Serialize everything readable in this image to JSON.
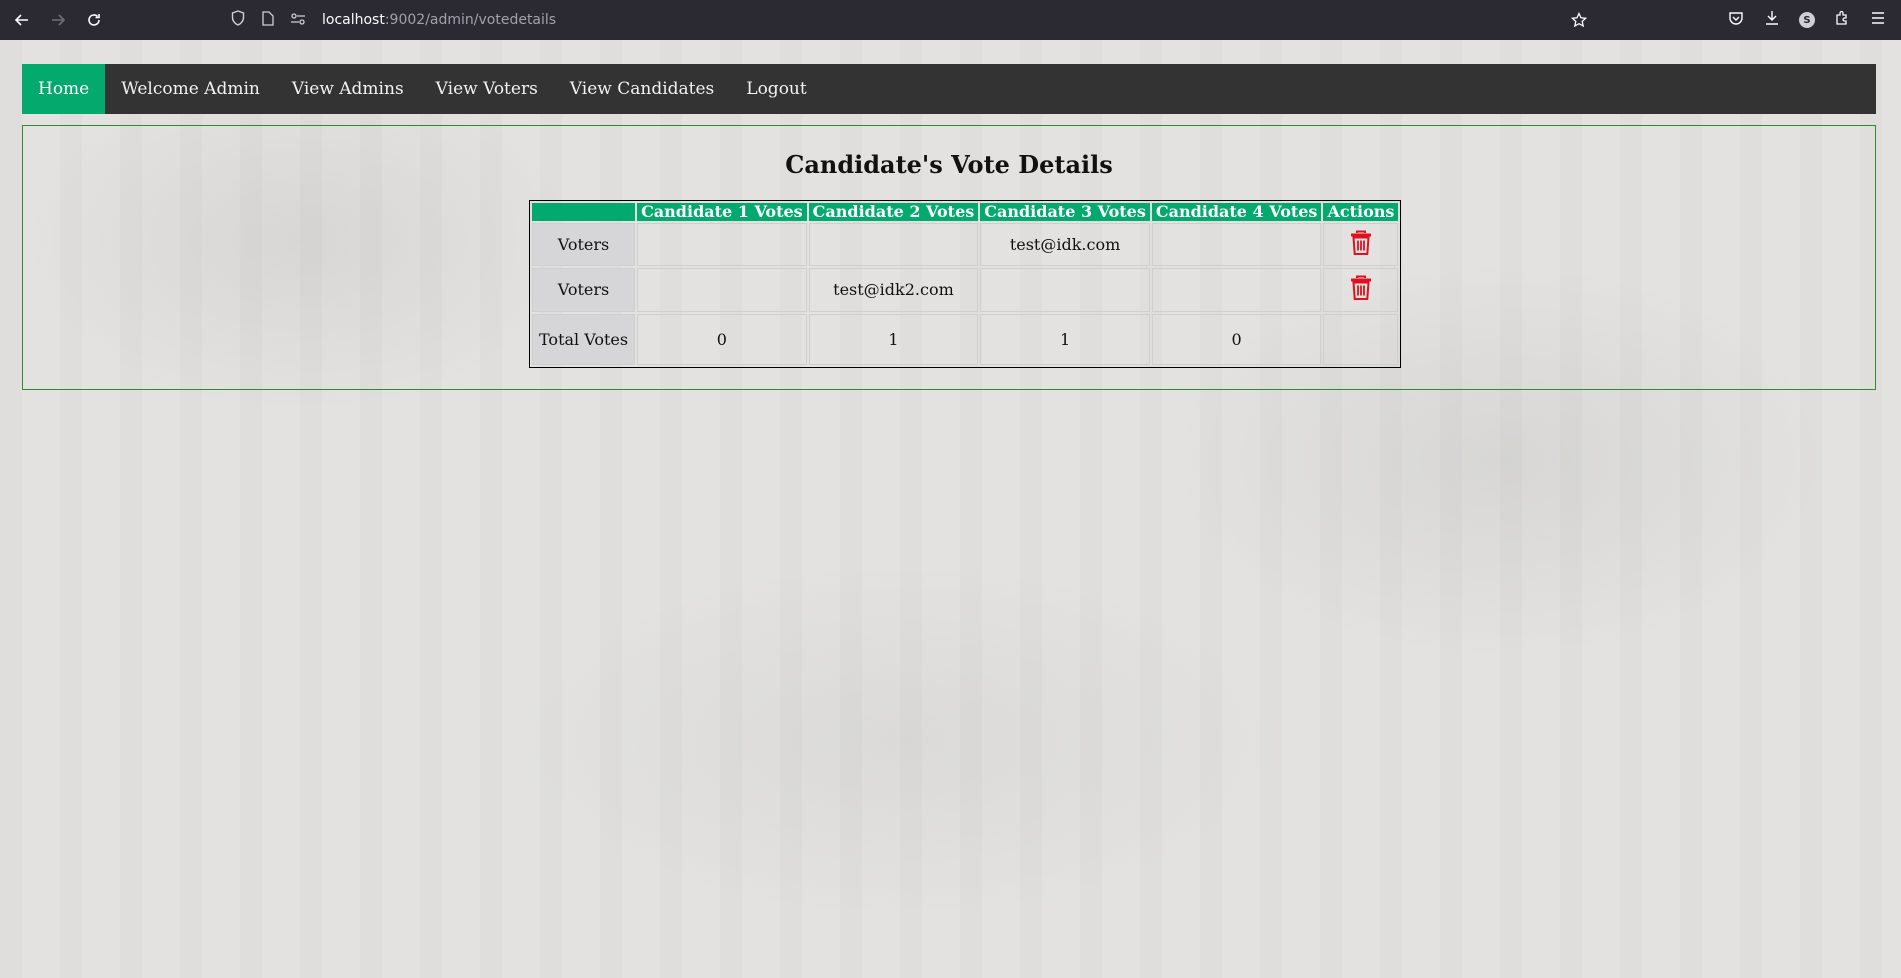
{
  "browser": {
    "url_host": "localhost",
    "url_path": ":9002/admin/votedetails",
    "profile_initial": "S"
  },
  "navbar": {
    "items": [
      {
        "label": "Home",
        "active": true
      },
      {
        "label": "Welcome Admin",
        "active": false
      },
      {
        "label": "View Admins",
        "active": false
      },
      {
        "label": "View Voters",
        "active": false
      },
      {
        "label": "View Candidates",
        "active": false
      },
      {
        "label": "Logout",
        "active": false
      }
    ]
  },
  "main": {
    "title": "Candidate's Vote Details",
    "table": {
      "headers": [
        "",
        "Candidate 1 Votes",
        "Candidate 2 Votes",
        "Candidate 3 Votes",
        "Candidate 4 Votes",
        "Actions"
      ],
      "rows": [
        {
          "label": "Voters",
          "cells": [
            "",
            "",
            "test@idk.com",
            ""
          ],
          "action_icon": "trash-icon"
        },
        {
          "label": "Voters",
          "cells": [
            "",
            "test@idk2.com",
            "",
            ""
          ],
          "action_icon": "trash-icon"
        }
      ],
      "totals": {
        "label": "Total Votes",
        "cells": [
          "0",
          "1",
          "1",
          "0"
        ]
      }
    }
  },
  "colors": {
    "accent": "#04aa6d",
    "navbar_bg": "#333333",
    "delete": "#e0101f",
    "panel_border": "#2e8b2e"
  }
}
